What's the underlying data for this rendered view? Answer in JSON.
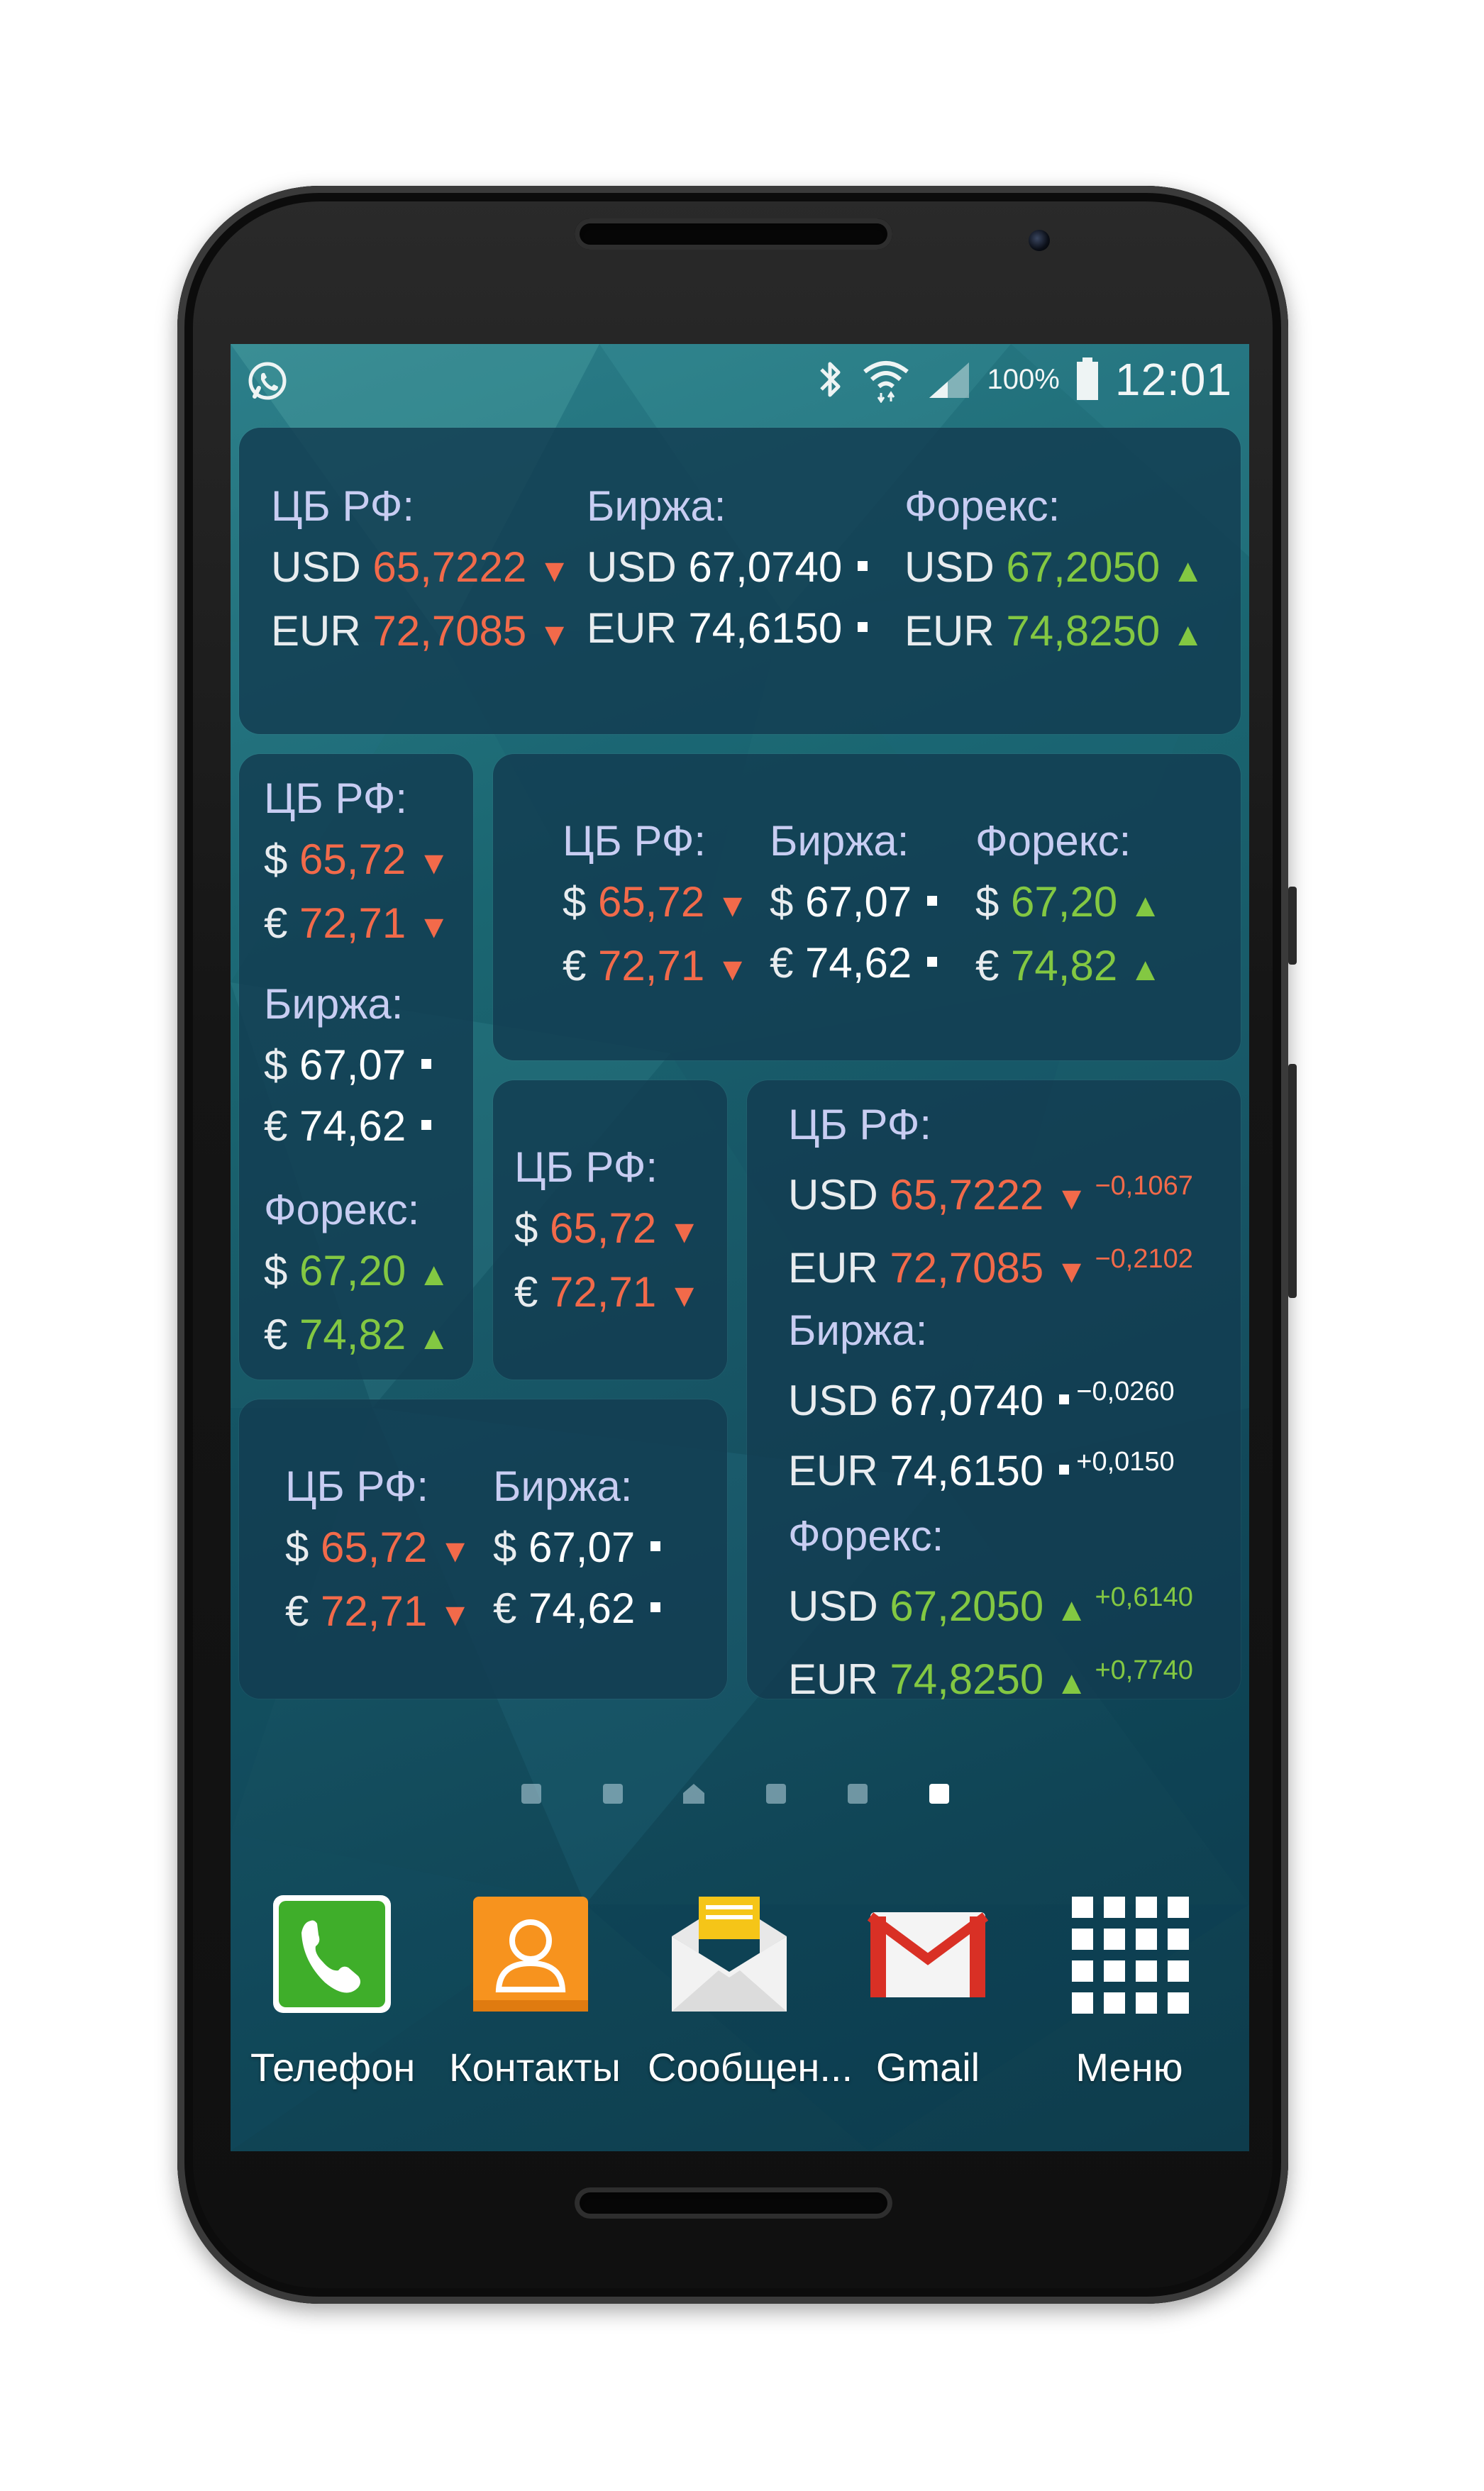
{
  "status_bar": {
    "battery_percent": "100%",
    "time": "12:01",
    "icons": [
      "whatsapp-icon",
      "bluetooth-icon",
      "wifi-icon",
      "signal-icon",
      "battery-icon"
    ]
  },
  "widgets": {
    "large": {
      "columns": [
        {
          "header": "ЦБ РФ:",
          "rows": [
            {
              "cur": "USD",
              "value": "65,7222",
              "trend": "down"
            },
            {
              "cur": "EUR",
              "value": "72,7085",
              "trend": "down"
            }
          ]
        },
        {
          "header": "Биржа:",
          "rows": [
            {
              "cur": "USD",
              "value": "67,0740",
              "trend": "flat"
            },
            {
              "cur": "EUR",
              "value": "74,6150",
              "trend": "flat"
            }
          ]
        },
        {
          "header": "Форекс:",
          "rows": [
            {
              "cur": "USD",
              "value": "67,2050",
              "trend": "up"
            },
            {
              "cur": "EUR",
              "value": "74,8250",
              "trend": "up"
            }
          ]
        }
      ]
    },
    "tall": {
      "groups": [
        {
          "header": "ЦБ РФ:",
          "rows": [
            {
              "cur": "$",
              "value": "65,72"
            },
            {
              "cur": "€",
              "value": "72,71"
            }
          ]
        },
        {
          "header": "Биржа:",
          "rows": [
            {
              "cur": "$",
              "value": "67,07"
            },
            {
              "cur": "€",
              "value": "74,62"
            }
          ]
        },
        {
          "header": "Форекс:",
          "rows": [
            {
              "cur": "$",
              "value": "67,20"
            },
            {
              "cur": "€",
              "value": "74,82"
            }
          ]
        }
      ]
    },
    "medium": {
      "columns": [
        {
          "header": "ЦБ РФ:",
          "rows": [
            {
              "cur": "$",
              "value": "65,72"
            },
            {
              "cur": "€",
              "value": "72,71"
            }
          ]
        },
        {
          "header": "Биржа:",
          "rows": [
            {
              "cur": "$",
              "value": "67,07"
            },
            {
              "cur": "€",
              "value": "74,62"
            }
          ]
        },
        {
          "header": "Форекс:",
          "rows": [
            {
              "cur": "$",
              "value": "67,20"
            },
            {
              "cur": "€",
              "value": "74,82"
            }
          ]
        }
      ]
    },
    "small": {
      "header": "ЦБ РФ:",
      "rows": [
        {
          "cur": "$",
          "value": "65,72"
        },
        {
          "cur": "€",
          "value": "72,71"
        }
      ]
    },
    "detailed": {
      "groups": [
        {
          "header": "ЦБ РФ:",
          "rows": [
            {
              "cur": "USD",
              "value": "65,7222",
              "delta": "−0,1067"
            },
            {
              "cur": "EUR",
              "value": "72,7085",
              "delta": "−0,2102"
            }
          ]
        },
        {
          "header": "Биржа:",
          "rows": [
            {
              "cur": "USD",
              "value": "67,0740",
              "delta": "−0,0260"
            },
            {
              "cur": "EUR",
              "value": "74,6150",
              "delta": "+0,0150"
            }
          ]
        },
        {
          "header": "Форекс:",
          "rows": [
            {
              "cur": "USD",
              "value": "67,2050",
              "delta": "+0,6140"
            },
            {
              "cur": "EUR",
              "value": "74,8250",
              "delta": "+0,7740"
            }
          ]
        }
      ]
    },
    "wide": {
      "columns": [
        {
          "header": "ЦБ РФ:",
          "rows": [
            {
              "cur": "$",
              "value": "65,72"
            },
            {
              "cur": "€",
              "value": "72,71"
            }
          ]
        },
        {
          "header": "Биржа:",
          "rows": [
            {
              "cur": "$",
              "value": "67,07"
            },
            {
              "cur": "€",
              "value": "74,62"
            }
          ]
        }
      ]
    }
  },
  "page_indicator": {
    "count": 6,
    "home_index": 2,
    "active_index": 5
  },
  "dock": [
    {
      "label": "Телефон",
      "icon": "phone-icon"
    },
    {
      "label": "Контакты",
      "icon": "contacts-icon"
    },
    {
      "label": "Сообщен...",
      "icon": "messages-icon"
    },
    {
      "label": "Gmail",
      "icon": "gmail-icon"
    },
    {
      "label": "Меню",
      "icon": "apps-grid-icon"
    }
  ],
  "colors": {
    "down": "#f26a4a",
    "up": "#83c842",
    "header": "#c8cdf2",
    "widget_bg": "#123c50"
  }
}
